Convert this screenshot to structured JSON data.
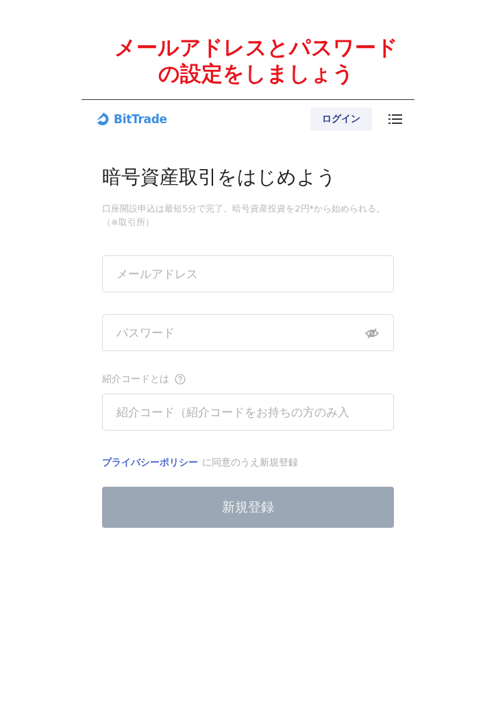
{
  "caption": {
    "lines": [
      "メールアドレスとパスワード",
      "の設定をしましょう"
    ]
  },
  "header": {
    "logo": "BitTrade",
    "login_button": "ログイン"
  },
  "heading": "暗号資産取引をはじめよう",
  "description": "口座開設申込は最短5分で完了。暗号資産投資を2円*から始められる。（※取引所）",
  "fields": [
    {
      "kind": "text",
      "placeholder": "メールアドレス"
    },
    {
      "kind": "password",
      "placeholder": "パスワード"
    },
    {
      "kind": "labeled",
      "label": "紹介コードとは",
      "placeholder": "紹介コード（紹介コードをお持ちの方のみ入"
    }
  ],
  "consent": {
    "link": "プライバシーポリシー",
    "text": "に同意のうえ新規登録"
  },
  "submit": {
    "label": "新規登録",
    "disabled": true
  }
}
